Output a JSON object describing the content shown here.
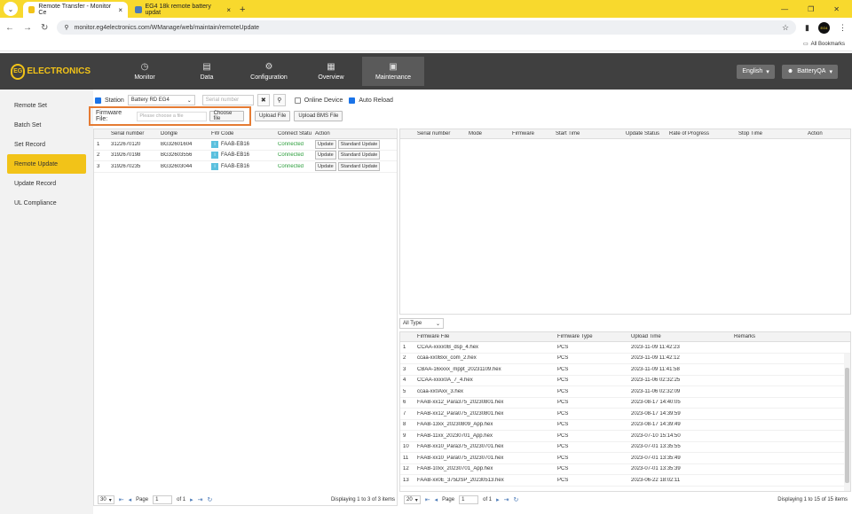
{
  "browser": {
    "tabs": [
      {
        "label": "Remote Transfer - Monitor Ce",
        "active": true
      },
      {
        "label": "EG4 18k remote battery updat",
        "active": false
      }
    ],
    "url": "monitor.eg4electronics.com/WManage/web/maintain/remoteUpdate",
    "bookmarks_label": "All Bookmarks",
    "profile_label": "EG4"
  },
  "appnav": {
    "logo_text": "ELECTRONICS",
    "logo_mark": "EG",
    "items": [
      {
        "label": "Monitor",
        "icon": "dashboard-icon"
      },
      {
        "label": "Data",
        "icon": "database-icon"
      },
      {
        "label": "Configuration",
        "icon": "gear-icon"
      },
      {
        "label": "Overview",
        "icon": "grid-icon"
      },
      {
        "label": "Maintenance",
        "icon": "toolbox-icon",
        "active": true
      }
    ],
    "language": "English",
    "user": "BatteryQA"
  },
  "sidebar": {
    "items": [
      {
        "label": "Remote Set"
      },
      {
        "label": "Batch Set"
      },
      {
        "label": "Set Record"
      },
      {
        "label": "Remote Update",
        "active": true
      },
      {
        "label": "Update Record"
      },
      {
        "label": "UL Compliance"
      }
    ]
  },
  "filters": {
    "station_label": "Station",
    "station_value": "Battery RD EG4",
    "serial_placeholder": "Serial number",
    "online_device_label": "Online Device",
    "auto_reload_label": "Auto Reload",
    "firmware_file_label": "Firmware File:",
    "firmware_placeholder": "Please choose a file",
    "choose_file_label": "Choose file",
    "upload_file_label": "Upload File",
    "upload_bms_label": "Upload BMS File"
  },
  "devices": {
    "columns": [
      "",
      "Serial number",
      "Dongle",
      "FW Code",
      "Connect Statu",
      "Action"
    ],
    "rows": [
      {
        "n": "1",
        "serial": "3122670120",
        "dongle": "BG32601604",
        "fw": "FAAB-EB16",
        "status": "Connected"
      },
      {
        "n": "2",
        "serial": "3192670198",
        "dongle": "BG32603556",
        "fw": "FAAB-EB16",
        "status": "Connected"
      },
      {
        "n": "3",
        "serial": "3192670235",
        "dongle": "BG32603044",
        "fw": "FAAB-EB16",
        "status": "Connected"
      }
    ],
    "update_label": "Update",
    "standard_update_label": "Standard Update",
    "pager": {
      "page_size": "30",
      "page_label": "Page",
      "page": "1",
      "of_label": "of 1",
      "display": "Displaying 1 to 3 of 3 items"
    }
  },
  "progress": {
    "columns": [
      "",
      "Serial number",
      "Mode",
      "Firmware",
      "Start Time",
      "Update Status",
      "Rate of Progress",
      "Stop Time",
      "Action"
    ]
  },
  "firmware": {
    "type_filter": "All Type",
    "columns": [
      "",
      "Firmware File",
      "Firmware Type",
      "Upload Time",
      "Remarks"
    ],
    "rows": [
      {
        "n": "1",
        "file": "CCAA-xxxx0B_dsp_4.hex",
        "type": "PCS",
        "time": "2023-11-09 11:42:23"
      },
      {
        "n": "2",
        "file": "ccaa-xx0Bxx_com_2.hex",
        "type": "PCS",
        "time": "2023-11-09 11:42:12"
      },
      {
        "n": "3",
        "file": "CBAA-16xxxx_mppt_20231109.hex",
        "type": "PCS",
        "time": "2023-11-09 11:41:58"
      },
      {
        "n": "4",
        "file": "CCAA-xxxx0A_7_4.hex",
        "type": "PCS",
        "time": "2023-11-06 02:32:25"
      },
      {
        "n": "5",
        "file": "ccaa-xx0Axx_3.hex",
        "type": "PCS",
        "time": "2023-11-06 02:32:09"
      },
      {
        "n": "6",
        "file": "FAAB-xx12_Para375_20230801.hex",
        "type": "PCS",
        "time": "2023-08-17 14:40:05"
      },
      {
        "n": "7",
        "file": "FAAB-xx12_Para075_20230801.hex",
        "type": "PCS",
        "time": "2023-08-17 14:39:59"
      },
      {
        "n": "8",
        "file": "FAAB-13xx_20230809_App.hex",
        "type": "PCS",
        "time": "2023-08-17 14:39:49"
      },
      {
        "n": "9",
        "file": "FAAB-11xx_20230701_App.hex",
        "type": "PCS",
        "time": "2023-07-10 15:14:50"
      },
      {
        "n": "10",
        "file": "FAAB-xx10_Para375_20230701.hex",
        "type": "PCS",
        "time": "2023-07-01 13:35:55"
      },
      {
        "n": "11",
        "file": "FAAB-xx10_Para075_20230701.hex",
        "type": "PCS",
        "time": "2023-07-01 13:35:49"
      },
      {
        "n": "12",
        "file": "FAAB-10xx_20230701_App.hex",
        "type": "PCS",
        "time": "2023-07-01 13:35:39"
      },
      {
        "n": "13",
        "file": "FAAB-xx0E_375DSP_20230513.hex",
        "type": "PCS",
        "time": "2023-06-22 18:02:11"
      }
    ],
    "pager": {
      "page_size": "20",
      "page_label": "Page",
      "page": "1",
      "of_label": "of 1",
      "display": "Displaying 1 to 15 of 15 items"
    }
  }
}
